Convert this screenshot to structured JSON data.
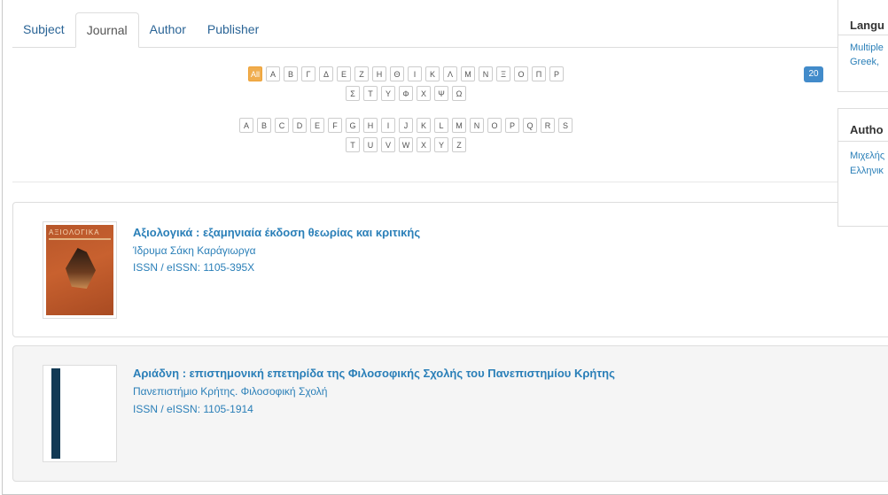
{
  "tabs": [
    "Subject",
    "Journal",
    "Author",
    "Publisher"
  ],
  "active_tab": "Journal",
  "letters": {
    "greek_row1": [
      "All",
      "Α",
      "Β",
      "Γ",
      "Δ",
      "Ε",
      "Ζ",
      "Η",
      "Θ",
      "Ι",
      "Κ",
      "Λ",
      "Μ",
      "Ν",
      "Ξ",
      "Ο",
      "Π",
      "Ρ"
    ],
    "greek_row2": [
      "Σ",
      "Τ",
      "Υ",
      "Φ",
      "Χ",
      "Ψ",
      "Ω"
    ],
    "latin_row1": [
      "A",
      "B",
      "C",
      "D",
      "E",
      "F",
      "G",
      "H",
      "I",
      "J",
      "K",
      "L",
      "M",
      "N",
      "O",
      "P",
      "Q",
      "R",
      "S"
    ],
    "latin_row2": [
      "T",
      "U",
      "V",
      "W",
      "X",
      "Y",
      "Z"
    ]
  },
  "count": "20",
  "results": [
    {
      "title": "Αξιολογικά : εξαμηνιαία έκδοση θεωρίας και κριτικής",
      "publisher": "Ίδρυμα Σάκη Καράγιωργα",
      "issn": "ISSN / eISSN: 1105-395X",
      "cover_text": "ΑΞΙΟΛΟΓΙΚΑ"
    },
    {
      "title": "Αριάδνη : επιστημονική επετηρίδα της Φιλοσοφικής Σχολής του Πανεπιστημίου Κρήτης",
      "publisher": "Πανεπιστήμιο Κρήτης. Φιλοσοφική Σχολή",
      "issn": "ISSN / eISSN: 1105-1914"
    }
  ],
  "side": {
    "panel1_title": "Langu",
    "panel1_links": [
      "Multiple",
      "Greek,"
    ],
    "panel2_title": "Autho",
    "panel2_links": [
      "Μιχελής",
      "Ελληνικ"
    ]
  },
  "colors": {
    "accent": "#f0ad4e",
    "link": "#2a7fb8",
    "badge": "#428bca"
  }
}
